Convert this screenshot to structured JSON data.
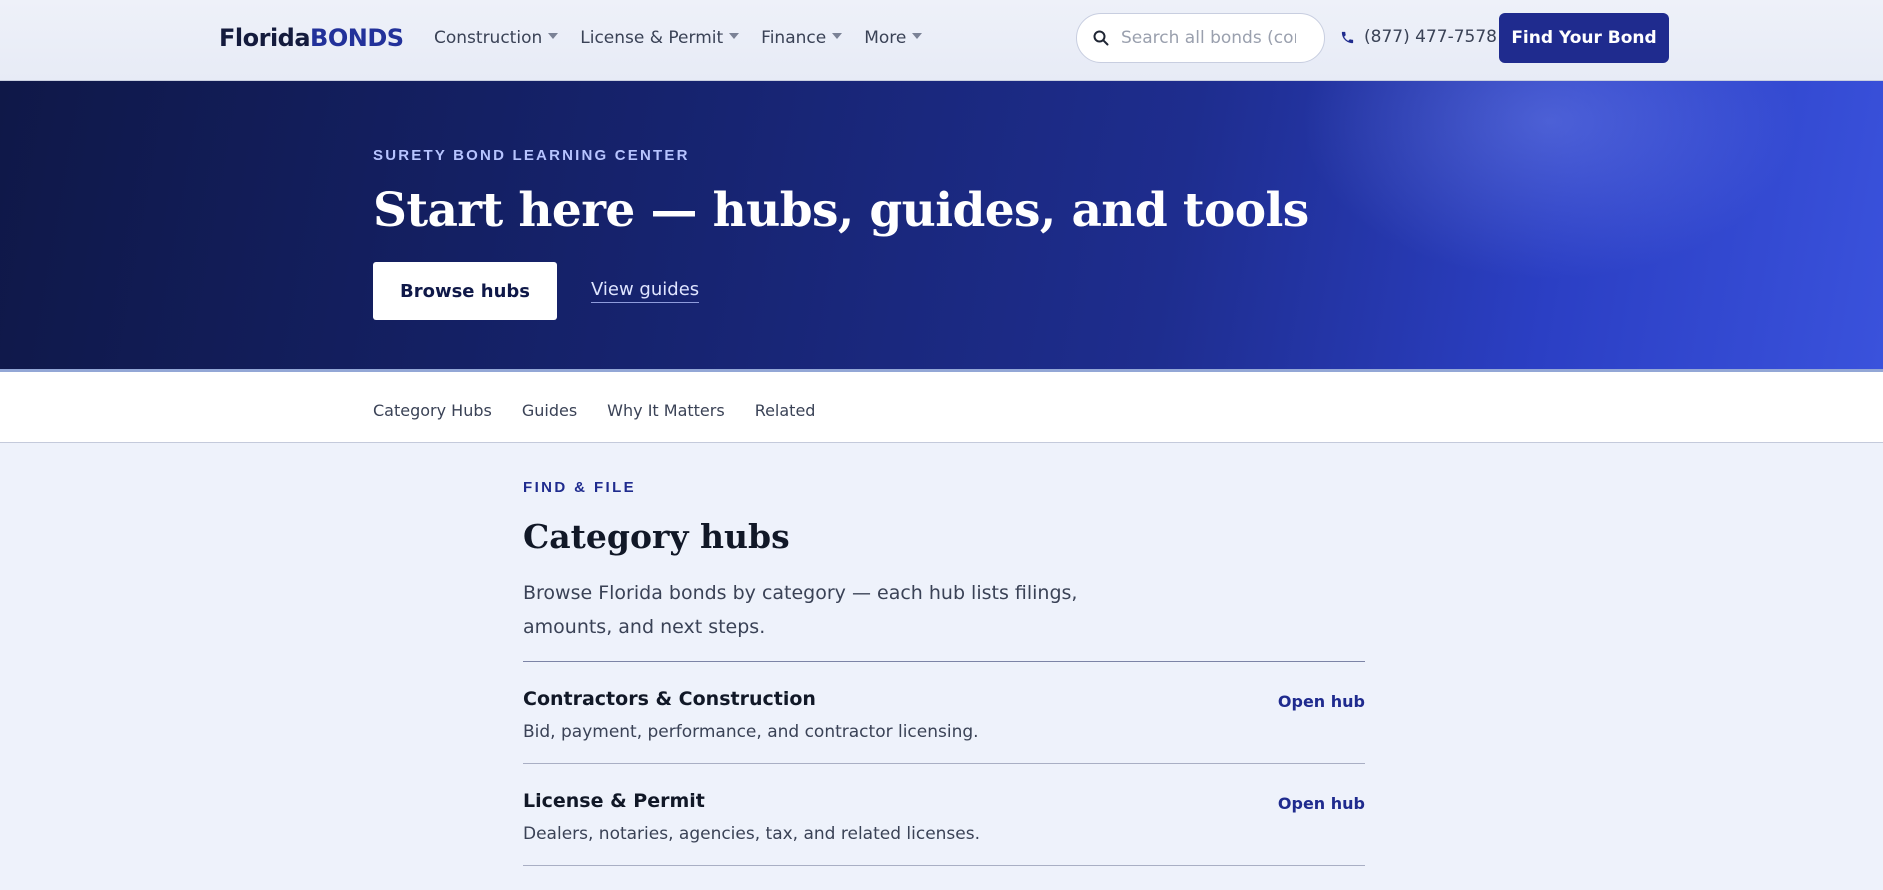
{
  "header": {
    "logo_part1": "Florida",
    "logo_part2": "BONDS",
    "nav": [
      {
        "label": "Construction"
      },
      {
        "label": "License & Permit"
      },
      {
        "label": "Finance"
      },
      {
        "label": "More"
      }
    ],
    "search_placeholder": "Search all bonds (contractor, notary, auto dealer…)",
    "phone": "(877) 477-7578",
    "cta": "Find Your Bond"
  },
  "hero": {
    "eyebrow": "SURETY BOND LEARNING CENTER",
    "title": "Start here — hubs, guides, and tools",
    "primary_button": "Browse hubs",
    "secondary_link": "View guides"
  },
  "subnav": {
    "items": [
      {
        "label": "Category Hubs"
      },
      {
        "label": "Guides"
      },
      {
        "label": "Why It Matters"
      },
      {
        "label": "Related"
      }
    ]
  },
  "section": {
    "eyebrow": "FIND & FILE",
    "title": "Category hubs",
    "description": "Browse Florida bonds by category — each hub lists filings, amounts, and next steps.",
    "hubs": [
      {
        "title": "Contractors & Construction",
        "desc": "Bid, payment, performance, and contractor licensing.",
        "link": "Open hub"
      },
      {
        "title": "License & Permit",
        "desc": "Dealers, notaries, agencies, tax, and related licenses.",
        "link": "Open hub"
      }
    ]
  },
  "colors": {
    "brand_navy": "#1f2b8e",
    "hero_dark": "#0f1848",
    "hero_light": "#3a52dc"
  }
}
